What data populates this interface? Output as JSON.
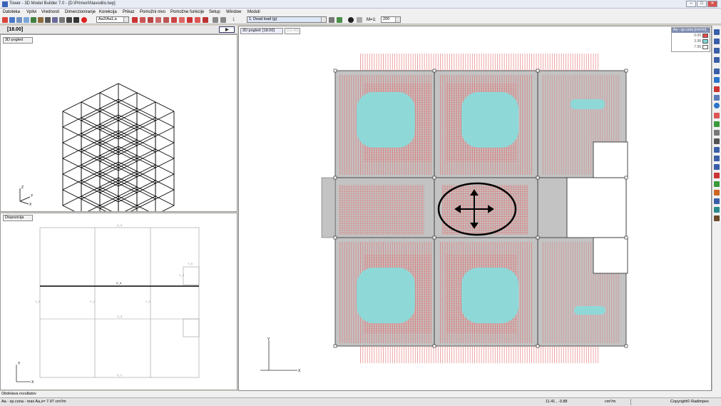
{
  "window": {
    "title": "Tower - 3D Model Builder 7.0 - [D:\\Primeri\\Navodilo.twp]",
    "min": "–",
    "max": "□",
    "close": "✕"
  },
  "menu": [
    "Datoteka",
    "Vplivi",
    "Vrednosti",
    "Dimenzioniranje",
    "Korekcija",
    "Prikaz",
    "Pomožni nivo",
    "Pomožne funkcije",
    "Setup",
    "Window",
    "Moduli"
  ],
  "toolbar": {
    "result_combo": "Aa2/Aa1,a",
    "load_combo": "1. Dead load (g)",
    "step": "1",
    "scale_label": "M=1:",
    "scale_value": "200"
  },
  "left": {
    "level": "[18.00]",
    "view3d_combo": "3D pogled",
    "disposition_combo": "Dispozicija",
    "axis_x": "X",
    "axis_y": "Y",
    "axis_z": "Z"
  },
  "grid_labels": {
    "top": "X_4",
    "mid": "X_4",
    "low": "X_3",
    "bottom": "X_1",
    "y1": "Y_1",
    "y2": "Y_2",
    "y3": "Y_3",
    "y4": "Y_4",
    "y5": "Y_5"
  },
  "main": {
    "view_combo": "2D pogled: [18.00]",
    "level_box": "[12.00]",
    "axis_x": "X",
    "axis_y": "Y"
  },
  "legend": {
    "title": "Aa - sp.cona [cm²/m]",
    "values": [
      "0.00",
      "3.98",
      "7.96"
    ],
    "colors": [
      "#e84a4a",
      "#7fd6d6",
      "#ffffff"
    ]
  },
  "status": {
    "hint": "Obdelava rezultatov",
    "result": "Aa - sp.cona - max Aa,s= 7.97 cm²/m",
    "coords": "11.41 , -3.88",
    "unit": "cm²/m",
    "copyright": "Copyright© Radimpex"
  }
}
